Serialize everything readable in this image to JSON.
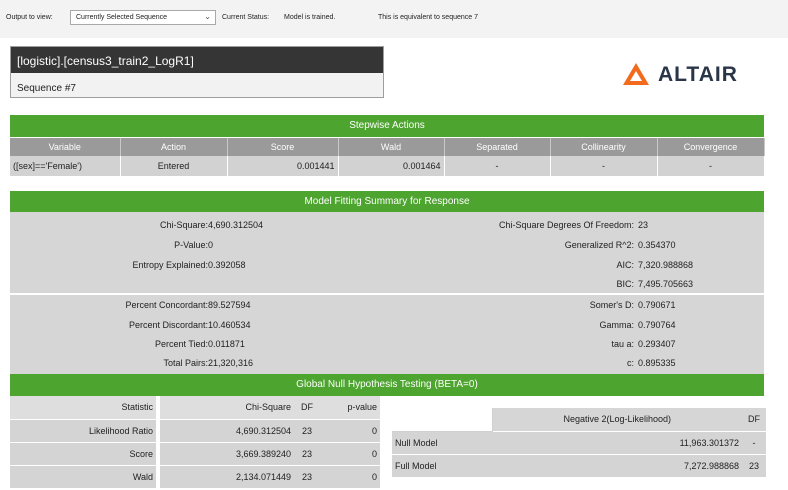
{
  "toolbar": {
    "output_label": "Output to view:",
    "output_value": "Currently Selected Sequence",
    "status_label": "Current Status:",
    "status_value": "Model is trained.",
    "equiv_text": "This is equivalent to sequence 7"
  },
  "model": {
    "title": "[logistic].[census3_train2_LogR1]",
    "sequence": "Sequence #7"
  },
  "logo": {
    "text": "ALTAIR",
    "accent": "#f26a1b"
  },
  "colors": {
    "green": "#4da42f",
    "header_gray": "#9a9a9a",
    "row_gray": "#d2d2d2"
  },
  "stepwise": {
    "title": "Stepwise Actions",
    "columns": [
      "Variable",
      "Action",
      "Score",
      "Wald",
      "Separated",
      "Collinearity",
      "Convergence"
    ],
    "rows": [
      [
        "([sex]=='Female')",
        "Entered",
        "0.001441",
        "0.001464",
        "-",
        "-",
        "-"
      ]
    ]
  },
  "model_fit": {
    "title": "Model Fitting Summary for Response",
    "left_top": [
      {
        "label": "Chi-Square:",
        "value": "4,690.312504"
      },
      {
        "label": "P-Value:",
        "value": "0"
      },
      {
        "label": "Entropy Explained:",
        "value": "0.392058"
      }
    ],
    "right_top": [
      {
        "label": "Chi-Square Degrees Of Freedom:",
        "value": "23"
      },
      {
        "label": "Generalized R^2:",
        "value": "0.354370"
      },
      {
        "label": "AIC:",
        "value": "7,320.988868"
      },
      {
        "label": "BIC:",
        "value": "7,495.705663"
      }
    ],
    "left_bottom": [
      {
        "label": "Percent Concordant:",
        "value": "89.527594"
      },
      {
        "label": "Percent Discordant:",
        "value": "10.460534"
      },
      {
        "label": "Percent Tied:",
        "value": "0.011871"
      },
      {
        "label": "Total Pairs:",
        "value": "21,320,316"
      }
    ],
    "right_bottom": [
      {
        "label": "Somer's D:",
        "value": "0.790671"
      },
      {
        "label": "Gamma:",
        "value": "0.790764"
      },
      {
        "label": "tau a:",
        "value": "0.293407"
      },
      {
        "label": "c:",
        "value": "0.895335"
      }
    ]
  },
  "global_null": {
    "title": "Global Null Hypothesis Testing (BETA=0)",
    "left_columns": [
      "Statistic",
      "Chi-Square",
      "DF",
      "p-value"
    ],
    "left_rows": [
      [
        "Likelihood Ratio",
        "4,690.312504",
        "23",
        "0"
      ],
      [
        "Score",
        "3,669.389240",
        "23",
        "0"
      ],
      [
        "Wald",
        "2,134.071449",
        "23",
        "0"
      ]
    ],
    "right_columns": [
      "Negative 2(Log-Likelihood)",
      "DF"
    ],
    "right_rows": [
      [
        "Null Model",
        "11,963.301372",
        "-"
      ],
      [
        "Full Model",
        "7,272.988868",
        "23"
      ]
    ]
  }
}
